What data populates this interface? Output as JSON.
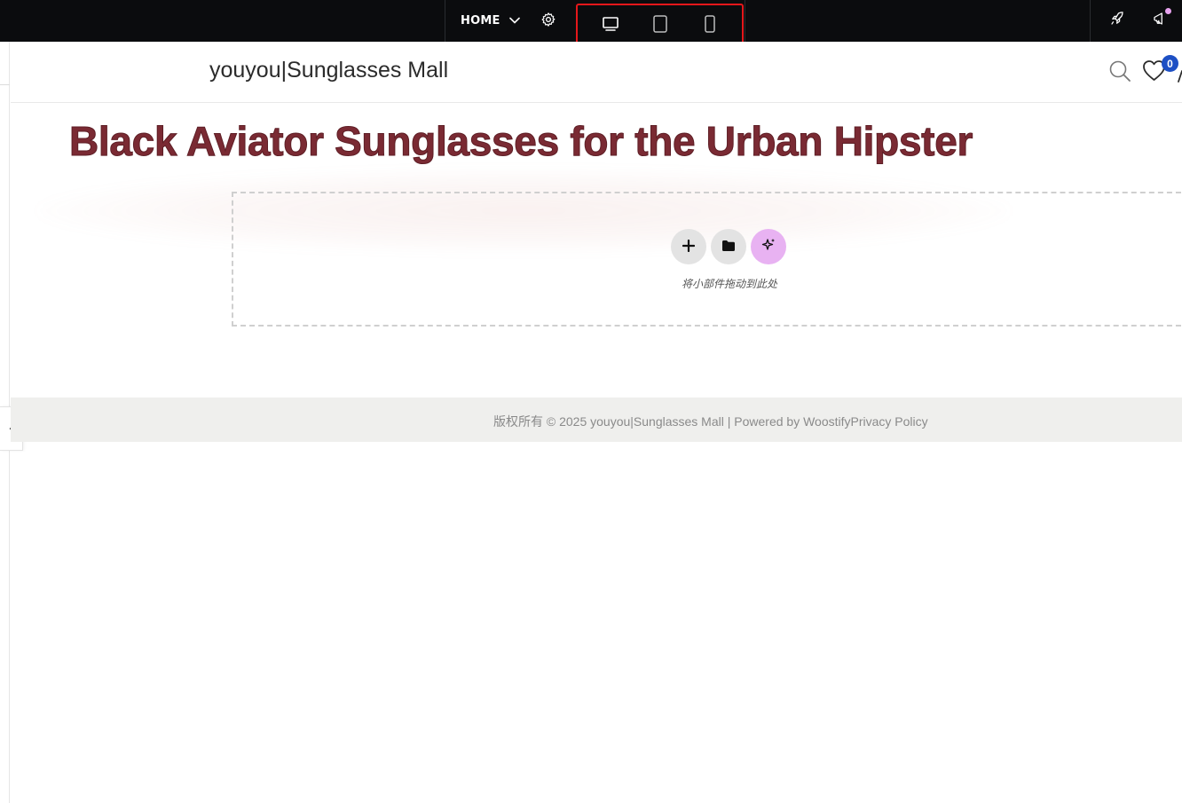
{
  "editor": {
    "page_label": "HOME",
    "icons": {
      "page_dropdown": "chevron-down-icon",
      "settings": "gear-icon",
      "desktop": "desktop-icon",
      "tablet": "tablet-icon",
      "mobile": "mobile-icon",
      "publish": "rocket-icon",
      "announcements": "megaphone-icon",
      "collapse": "chevron-left-icon"
    },
    "active_device": "desktop",
    "highlight_color": "#e5171a",
    "notification_dot_color": "#e7a2ee",
    "collapse_label": "‹"
  },
  "site": {
    "title": "youyou|Sunglasses Mall",
    "wishlist_count": "0",
    "badge_color": "#1d4fc4",
    "icons": {
      "search": "search-icon",
      "wishlist": "heart-icon",
      "cart": "bag-icon"
    }
  },
  "hero": {
    "heading": "Black Aviator Sunglasses for the Urban Hipster",
    "heading_color": "#7a2a33"
  },
  "drop_zone": {
    "hint": "将小部件拖动到此处",
    "add_label": "+",
    "icons": {
      "add": "plus-icon",
      "template": "folder-icon",
      "ai": "sparkle-icon"
    }
  },
  "footer": {
    "text": "版权所有 © 2025 youyou|Sunglasses Mall | Powered by WoostifyPrivacy Policy"
  }
}
